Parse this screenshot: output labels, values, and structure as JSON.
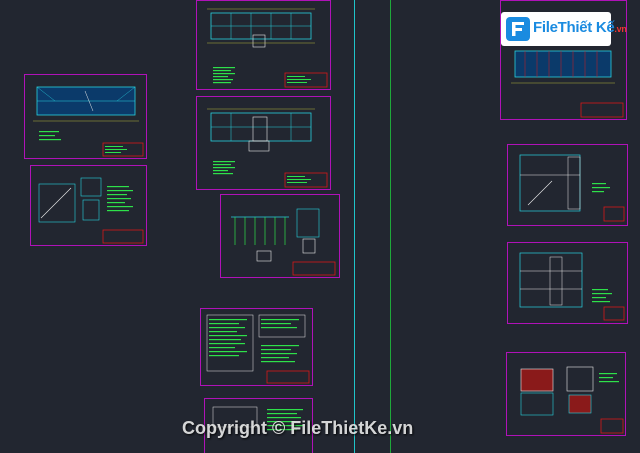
{
  "app": {
    "kind": "CAD model space view",
    "background": "#222630"
  },
  "colors": {
    "frame": "#b012b8",
    "title_block": "#d81a1a",
    "lines": "#27d3e0",
    "text": "#2ee04a",
    "axis_cyan": "#20c4c8",
    "axis_green": "#1fa83a"
  },
  "logo": {
    "name": "File",
    "name2": "Thiết Kế",
    "tld": ".vn"
  },
  "watermark": {
    "text": "Copyright © FileThietKe.vn"
  },
  "sheets": [
    {
      "id": "floor-plan-top-center",
      "kind": "plan"
    },
    {
      "id": "floor-plan-middle-center",
      "kind": "plan"
    },
    {
      "id": "roof-plan-left",
      "kind": "plan"
    },
    {
      "id": "stair-detail-left",
      "kind": "detail"
    },
    {
      "id": "structure-detail-center",
      "kind": "detail"
    },
    {
      "id": "schedule-table-center",
      "kind": "table"
    },
    {
      "id": "notes-bottom-center",
      "kind": "table"
    },
    {
      "id": "elevation-top-right",
      "kind": "plan"
    },
    {
      "id": "section-right-1",
      "kind": "section"
    },
    {
      "id": "section-right-2",
      "kind": "section"
    },
    {
      "id": "detail-bottom-right",
      "kind": "detail"
    }
  ]
}
